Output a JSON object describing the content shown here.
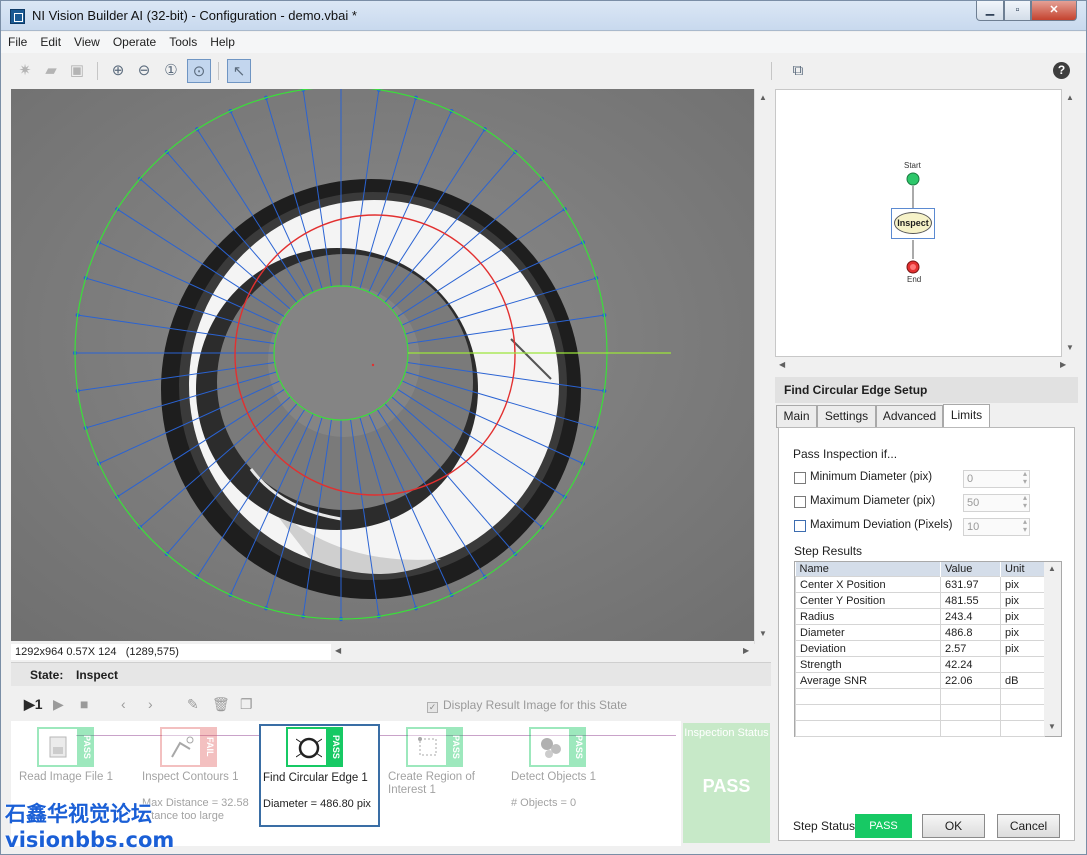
{
  "window": {
    "title": "NI Vision Builder AI (32-bit) - Configuration - demo.vbai *"
  },
  "menu": [
    "File",
    "Edit",
    "View",
    "Operate",
    "Tools",
    "Help"
  ],
  "image_status": {
    "info": "1292x964 0.57X 124",
    "coords": "(1289,575)"
  },
  "state": {
    "label": "State:",
    "value": "Inspect"
  },
  "display_result_label": "Display Result Image for this State",
  "steps": [
    {
      "name": "Read Image File 1",
      "status": "PASS",
      "result": "",
      "faded": true
    },
    {
      "name": "Inspect Contours 1",
      "status": "FAIL",
      "result": "Max Distance = 32.58\n...tance too large",
      "faded": true
    },
    {
      "name": "Find Circular Edge 1",
      "status": "PASS",
      "result": "Diameter = 486.80 pix",
      "faded": false
    },
    {
      "name": "Create Region of Interest 1",
      "status": "PASS",
      "result": "",
      "faded": true
    },
    {
      "name": "Detect Objects 1",
      "status": "PASS",
      "result": "# Objects = 0",
      "faded": true
    }
  ],
  "inspection_status": {
    "title": "Inspection Status",
    "value": "PASS"
  },
  "watermark": {
    "line1": "石鑫华视觉论坛",
    "line2": "visionbbs.com"
  },
  "flow": {
    "start": "Start",
    "state": "Inspect",
    "end": "End"
  },
  "setup": {
    "title": "Find Circular Edge Setup",
    "tabs": [
      "Main",
      "Settings",
      "Advanced",
      "Limits"
    ],
    "active_tab": "Limits",
    "pass_if": "Pass Inspection if...",
    "limits": [
      {
        "label": "Minimum Diameter (pix)",
        "value": "0"
      },
      {
        "label": "Maximum Diameter (pix)",
        "value": "50"
      },
      {
        "label": "Maximum Deviation (Pixels)",
        "value": "10"
      }
    ],
    "step_results_label": "Step Results",
    "columns": [
      "Name",
      "Value",
      "Unit"
    ],
    "rows": [
      [
        "Center X Position",
        "631.97",
        "pix"
      ],
      [
        "Center Y Position",
        "481.55",
        "pix"
      ],
      [
        "Radius",
        "243.4",
        "pix"
      ],
      [
        "Diameter",
        "486.8",
        "pix"
      ],
      [
        "Deviation",
        "2.57",
        "pix"
      ],
      [
        "Strength",
        "42.24",
        ""
      ],
      [
        "Average SNR",
        "22.06",
        "dB"
      ]
    ],
    "step_status_label": "Step Status",
    "step_status": "PASS",
    "ok_label": "OK",
    "cancel_label": "Cancel"
  },
  "colors": {
    "pass": "#17c964",
    "fail": "#e46a6a",
    "accent": "#3a6ea5"
  }
}
